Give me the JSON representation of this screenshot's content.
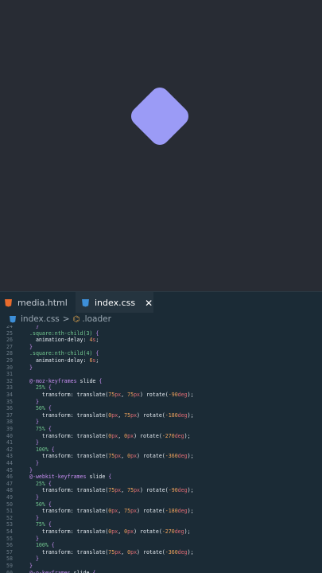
{
  "tabs": [
    {
      "label": "media.html",
      "icon": "html5-icon",
      "active": false
    },
    {
      "label": "index.css",
      "icon": "css3-icon",
      "active": true,
      "close": "✕"
    }
  ],
  "breadcrumb": {
    "file": "index.css",
    "separator": ">",
    "symbol": ".loader"
  },
  "colors": {
    "preview_bg": "#282c34",
    "square": "#9b9bf6",
    "editor_bg": "#1b2b36"
  },
  "code_lines": [
    {
      "n": "24",
      "tokens": [
        {
          "t": "  }",
          "c": "tk-brace"
        }
      ]
    },
    {
      "n": "25",
      "tokens": [
        {
          "t": ".square:nth-child(3) ",
          "c": "tk-sel"
        },
        {
          "t": "{",
          "c": "tk-brace"
        }
      ]
    },
    {
      "n": "26",
      "tokens": [
        {
          "t": "  animation-delay: ",
          "c": "tk-prop"
        },
        {
          "t": "4",
          "c": "tk-num"
        },
        {
          "t": "s",
          "c": "tk-unit"
        },
        {
          "t": ";",
          "c": "tk-prop"
        }
      ]
    },
    {
      "n": "27",
      "tokens": [
        {
          "t": "}",
          "c": "tk-brace"
        }
      ]
    },
    {
      "n": "28",
      "tokens": [
        {
          "t": ".square:nth-child(4) ",
          "c": "tk-sel"
        },
        {
          "t": "{",
          "c": "tk-brace"
        }
      ]
    },
    {
      "n": "29",
      "tokens": [
        {
          "t": "  animation-delay: ",
          "c": "tk-prop"
        },
        {
          "t": "6",
          "c": "tk-num"
        },
        {
          "t": "s",
          "c": "tk-unit"
        },
        {
          "t": ";",
          "c": "tk-prop"
        }
      ]
    },
    {
      "n": "30",
      "tokens": [
        {
          "t": "}",
          "c": "tk-brace"
        }
      ]
    },
    {
      "n": "31",
      "tokens": []
    },
    {
      "n": "32",
      "tokens": [
        {
          "t": "@-moz-keyframes ",
          "c": "tk-kw"
        },
        {
          "t": "slide ",
          "c": "tk-prop"
        },
        {
          "t": "{",
          "c": "tk-brace"
        }
      ]
    },
    {
      "n": "33",
      "tokens": [
        {
          "t": "  25% ",
          "c": "tk-pct"
        },
        {
          "t": "{",
          "c": "tk-brace"
        }
      ]
    },
    {
      "n": "34",
      "tokens": [
        {
          "t": "    transform: translate(",
          "c": "tk-prop"
        },
        {
          "t": "75",
          "c": "tk-num"
        },
        {
          "t": "px",
          "c": "tk-unit"
        },
        {
          "t": ", ",
          "c": "tk-prop"
        },
        {
          "t": "75",
          "c": "tk-num"
        },
        {
          "t": "px",
          "c": "tk-unit"
        },
        {
          "t": ") rotate(",
          "c": "tk-prop"
        },
        {
          "t": "-90",
          "c": "tk-num"
        },
        {
          "t": "deg",
          "c": "tk-unit"
        },
        {
          "t": ");",
          "c": "tk-prop"
        }
      ]
    },
    {
      "n": "35",
      "tokens": [
        {
          "t": "  }",
          "c": "tk-brace"
        }
      ]
    },
    {
      "n": "36",
      "tokens": [
        {
          "t": "  50% ",
          "c": "tk-pct"
        },
        {
          "t": "{",
          "c": "tk-brace"
        }
      ]
    },
    {
      "n": "37",
      "tokens": [
        {
          "t": "    transform: translate(",
          "c": "tk-prop"
        },
        {
          "t": "0",
          "c": "tk-num"
        },
        {
          "t": "px",
          "c": "tk-unit"
        },
        {
          "t": ", ",
          "c": "tk-prop"
        },
        {
          "t": "75",
          "c": "tk-num"
        },
        {
          "t": "px",
          "c": "tk-unit"
        },
        {
          "t": ") rotate(",
          "c": "tk-prop"
        },
        {
          "t": "-180",
          "c": "tk-num"
        },
        {
          "t": "deg",
          "c": "tk-unit"
        },
        {
          "t": ");",
          "c": "tk-prop"
        }
      ]
    },
    {
      "n": "38",
      "tokens": [
        {
          "t": "  }",
          "c": "tk-brace"
        }
      ]
    },
    {
      "n": "39",
      "tokens": [
        {
          "t": "  75% ",
          "c": "tk-pct"
        },
        {
          "t": "{",
          "c": "tk-brace"
        }
      ]
    },
    {
      "n": "40",
      "tokens": [
        {
          "t": "    transform: translate(",
          "c": "tk-prop"
        },
        {
          "t": "0",
          "c": "tk-num"
        },
        {
          "t": "px",
          "c": "tk-unit"
        },
        {
          "t": ", ",
          "c": "tk-prop"
        },
        {
          "t": "0",
          "c": "tk-num"
        },
        {
          "t": "px",
          "c": "tk-unit"
        },
        {
          "t": ") rotate(",
          "c": "tk-prop"
        },
        {
          "t": "-270",
          "c": "tk-num"
        },
        {
          "t": "deg",
          "c": "tk-unit"
        },
        {
          "t": ");",
          "c": "tk-prop"
        }
      ]
    },
    {
      "n": "41",
      "tokens": [
        {
          "t": "  }",
          "c": "tk-brace"
        }
      ]
    },
    {
      "n": "42",
      "tokens": [
        {
          "t": "  100% ",
          "c": "tk-pct"
        },
        {
          "t": "{",
          "c": "tk-brace"
        }
      ]
    },
    {
      "n": "43",
      "tokens": [
        {
          "t": "    transform: translate(",
          "c": "tk-prop"
        },
        {
          "t": "75",
          "c": "tk-num"
        },
        {
          "t": "px",
          "c": "tk-unit"
        },
        {
          "t": ", ",
          "c": "tk-prop"
        },
        {
          "t": "0",
          "c": "tk-num"
        },
        {
          "t": "px",
          "c": "tk-unit"
        },
        {
          "t": ") rotate(",
          "c": "tk-prop"
        },
        {
          "t": "-360",
          "c": "tk-num"
        },
        {
          "t": "deg",
          "c": "tk-unit"
        },
        {
          "t": ");",
          "c": "tk-prop"
        }
      ]
    },
    {
      "n": "44",
      "tokens": [
        {
          "t": "  }",
          "c": "tk-brace"
        }
      ]
    },
    {
      "n": "45",
      "tokens": [
        {
          "t": "}",
          "c": "tk-brace"
        }
      ]
    },
    {
      "n": "46",
      "tokens": [
        {
          "t": "@-webkit-keyframes ",
          "c": "tk-kw"
        },
        {
          "t": "slide ",
          "c": "tk-prop"
        },
        {
          "t": "{",
          "c": "tk-brace"
        }
      ]
    },
    {
      "n": "47",
      "tokens": [
        {
          "t": "  25% ",
          "c": "tk-pct"
        },
        {
          "t": "{",
          "c": "tk-brace"
        }
      ]
    },
    {
      "n": "48",
      "tokens": [
        {
          "t": "    transform: translate(",
          "c": "tk-prop"
        },
        {
          "t": "75",
          "c": "tk-num"
        },
        {
          "t": "px",
          "c": "tk-unit"
        },
        {
          "t": ", ",
          "c": "tk-prop"
        },
        {
          "t": "75",
          "c": "tk-num"
        },
        {
          "t": "px",
          "c": "tk-unit"
        },
        {
          "t": ") rotate(",
          "c": "tk-prop"
        },
        {
          "t": "-90",
          "c": "tk-num"
        },
        {
          "t": "deg",
          "c": "tk-unit"
        },
        {
          "t": ");",
          "c": "tk-prop"
        }
      ]
    },
    {
      "n": "49",
      "tokens": [
        {
          "t": "  }",
          "c": "tk-brace"
        }
      ]
    },
    {
      "n": "50",
      "tokens": [
        {
          "t": "  50% ",
          "c": "tk-pct"
        },
        {
          "t": "{",
          "c": "tk-brace"
        }
      ]
    },
    {
      "n": "51",
      "tokens": [
        {
          "t": "    transform: translate(",
          "c": "tk-prop"
        },
        {
          "t": "0",
          "c": "tk-num"
        },
        {
          "t": "px",
          "c": "tk-unit"
        },
        {
          "t": ", ",
          "c": "tk-prop"
        },
        {
          "t": "75",
          "c": "tk-num"
        },
        {
          "t": "px",
          "c": "tk-unit"
        },
        {
          "t": ") rotate(",
          "c": "tk-prop"
        },
        {
          "t": "-180",
          "c": "tk-num"
        },
        {
          "t": "deg",
          "c": "tk-unit"
        },
        {
          "t": ");",
          "c": "tk-prop"
        }
      ]
    },
    {
      "n": "52",
      "tokens": [
        {
          "t": "  }",
          "c": "tk-brace"
        }
      ]
    },
    {
      "n": "53",
      "tokens": [
        {
          "t": "  75% ",
          "c": "tk-pct"
        },
        {
          "t": "{",
          "c": "tk-brace"
        }
      ]
    },
    {
      "n": "54",
      "tokens": [
        {
          "t": "    transform: translate(",
          "c": "tk-prop"
        },
        {
          "t": "0",
          "c": "tk-num"
        },
        {
          "t": "px",
          "c": "tk-unit"
        },
        {
          "t": ", ",
          "c": "tk-prop"
        },
        {
          "t": "0",
          "c": "tk-num"
        },
        {
          "t": "px",
          "c": "tk-unit"
        },
        {
          "t": ") rotate(",
          "c": "tk-prop"
        },
        {
          "t": "-270",
          "c": "tk-num"
        },
        {
          "t": "deg",
          "c": "tk-unit"
        },
        {
          "t": ");",
          "c": "tk-prop"
        }
      ]
    },
    {
      "n": "55",
      "tokens": [
        {
          "t": "  }",
          "c": "tk-brace"
        }
      ]
    },
    {
      "n": "56",
      "tokens": [
        {
          "t": "  100% ",
          "c": "tk-pct"
        },
        {
          "t": "{",
          "c": "tk-brace"
        }
      ]
    },
    {
      "n": "57",
      "tokens": [
        {
          "t": "    transform: translate(",
          "c": "tk-prop"
        },
        {
          "t": "75",
          "c": "tk-num"
        },
        {
          "t": "px",
          "c": "tk-unit"
        },
        {
          "t": ", ",
          "c": "tk-prop"
        },
        {
          "t": "0",
          "c": "tk-num"
        },
        {
          "t": "px",
          "c": "tk-unit"
        },
        {
          "t": ") rotate(",
          "c": "tk-prop"
        },
        {
          "t": "-360",
          "c": "tk-num"
        },
        {
          "t": "deg",
          "c": "tk-unit"
        },
        {
          "t": ");",
          "c": "tk-prop"
        }
      ]
    },
    {
      "n": "58",
      "tokens": [
        {
          "t": "  }",
          "c": "tk-brace"
        }
      ]
    },
    {
      "n": "59",
      "tokens": [
        {
          "t": "}",
          "c": "tk-brace"
        }
      ]
    },
    {
      "n": "60",
      "tokens": [
        {
          "t": "@-o-keyframes ",
          "c": "tk-kw"
        },
        {
          "t": "slide ",
          "c": "tk-prop"
        },
        {
          "t": "{",
          "c": "tk-brace"
        }
      ]
    }
  ]
}
